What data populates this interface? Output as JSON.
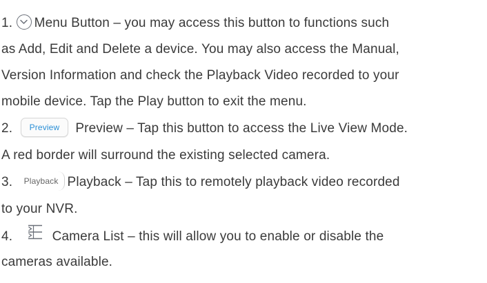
{
  "items": [
    {
      "number": "1.",
      "icon": "chevron-down-circle-icon",
      "lines": [
        "Menu Button – you may access this button to functions such",
        "as Add, Edit and Delete a device. You may also access the Manual,",
        "Version Information and check the Playback Video recorded to your",
        "mobile device. Tap the Play button to exit the menu."
      ]
    },
    {
      "number": "2.",
      "button_label": "Preview",
      "lines": [
        "Preview – Tap this button to access the Live View Mode.",
        "A red border will surround the existing selected camera."
      ]
    },
    {
      "number": "3.",
      "button_label": "Playback",
      "lines": [
        "Playback – Tap this to remotely playback video recorded",
        "to your NVR."
      ]
    },
    {
      "number": "4.",
      "icon": "camera-list-icon",
      "lines": [
        "Camera List – this will allow you to enable or disable the",
        "cameras available."
      ]
    }
  ],
  "colors": {
    "text": "#3a3a3a",
    "preview_button_text": "#2a8fd6",
    "icon_stroke": "#6b7079"
  }
}
